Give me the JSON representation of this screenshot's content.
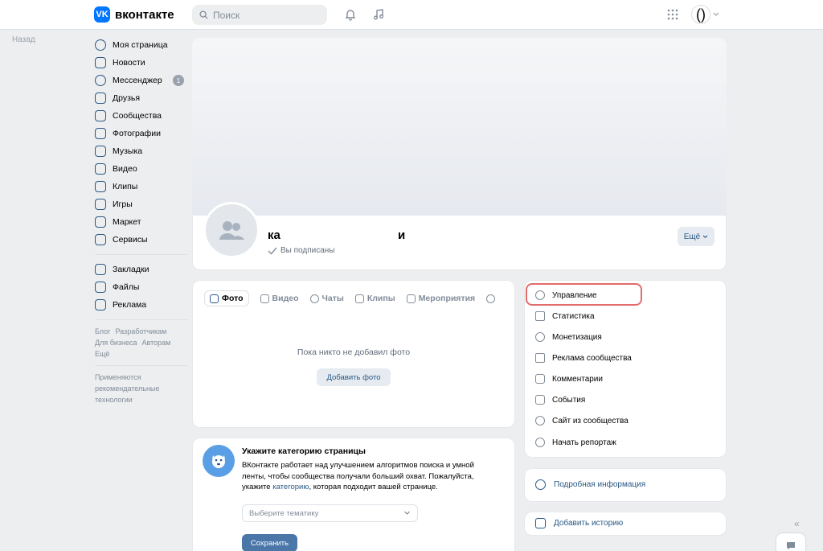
{
  "header": {
    "logo_text": "вконтакте",
    "logo_mark": "VK",
    "search_placeholder": "Поиск",
    "icons": [
      "bell-icon",
      "music-icon",
      "apps-grid-icon"
    ]
  },
  "back_label": "Назад",
  "sidebar": {
    "items": [
      {
        "label": "Моя страница",
        "icon": "user-circle-icon"
      },
      {
        "label": "Новости",
        "icon": "news-icon"
      },
      {
        "label": "Мессенджер",
        "icon": "message-icon",
        "badge": "1"
      },
      {
        "label": "Друзья",
        "icon": "friends-icon"
      },
      {
        "label": "Сообщества",
        "icon": "communities-icon"
      },
      {
        "label": "Фотографии",
        "icon": "photo-icon"
      },
      {
        "label": "Музыка",
        "icon": "music-icon"
      },
      {
        "label": "Видео",
        "icon": "video-icon"
      },
      {
        "label": "Клипы",
        "icon": "clips-icon"
      },
      {
        "label": "Игры",
        "icon": "gamepad-icon"
      },
      {
        "label": "Маркет",
        "icon": "bag-icon"
      },
      {
        "label": "Сервисы",
        "icon": "services-icon"
      }
    ],
    "items2": [
      {
        "label": "Закладки",
        "icon": "bookmark-icon"
      },
      {
        "label": "Файлы",
        "icon": "file-icon"
      },
      {
        "label": "Реклама",
        "icon": "megaphone-icon"
      }
    ],
    "footer_links": [
      "Блог",
      "Разработчикам",
      "Для бизнеса",
      "Авторам",
      "Ещё"
    ],
    "footer_note": "Применяются рекомендательные технологии"
  },
  "profile": {
    "name_part1": "ка",
    "name_part2": "и",
    "subscribed_label": "Вы подписаны",
    "more_label": "Ещё"
  },
  "content_tabs": {
    "tabs": [
      "Фото",
      "Видео",
      "Чаты",
      "Клипы",
      "Мероприятия"
    ],
    "empty_text": "Пока никто не добавил фото",
    "add_photo_label": "Добавить фото"
  },
  "category": {
    "title": "Укажите категорию страницы",
    "desc_before": "ВКонтакте работает над улучшением алгоритмов поиска и умной ленты, чтобы сообщества получали больший охват. Пожалуйста, укажите ",
    "desc_link": "категорию",
    "desc_after": ", которая подходит вашей странице.",
    "select_placeholder": "Выберите тематику",
    "save_label": "Сохранить"
  },
  "manage_menu": {
    "items": [
      {
        "label": "Управление",
        "icon": "gear-icon"
      },
      {
        "label": "Статистика",
        "icon": "chart-icon"
      },
      {
        "label": "Монетизация",
        "icon": "coin-icon"
      },
      {
        "label": "Реклама сообщества",
        "icon": "megaphone-icon"
      },
      {
        "label": "Комментарии",
        "icon": "comment-icon"
      },
      {
        "label": "События",
        "icon": "event-icon"
      },
      {
        "label": "Сайт из сообщества",
        "icon": "globe-icon"
      },
      {
        "label": "Начать репортаж",
        "icon": "broadcast-icon"
      }
    ]
  },
  "info": {
    "details_label": "Подробная информация",
    "story_label": "Добавить историю"
  },
  "colors": {
    "accent": "#0077ff",
    "link": "#2a5885",
    "highlight": "#e46b6b",
    "background": "#edeef0"
  }
}
